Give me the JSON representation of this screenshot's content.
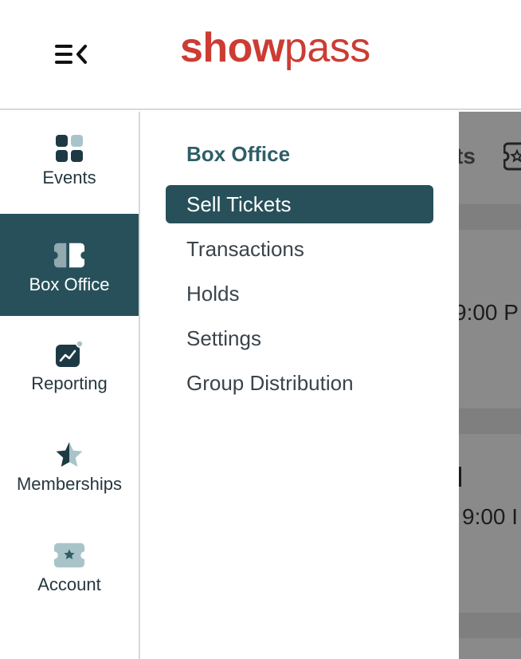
{
  "header": {
    "logo_bold": "show",
    "logo_light": "pass"
  },
  "rail": {
    "items": [
      {
        "label": "Events",
        "icon": "grid-icon"
      },
      {
        "label": "Box Office",
        "icon": "ticket-icon",
        "active": true
      },
      {
        "label": "Reporting",
        "icon": "chart-icon"
      },
      {
        "label": "Memberships",
        "icon": "star-icon"
      },
      {
        "label": "Account",
        "icon": "account-ticket-icon"
      }
    ]
  },
  "submenu": {
    "title": "Box Office",
    "items": [
      {
        "label": "Sell Tickets",
        "active": true
      },
      {
        "label": "Transactions"
      },
      {
        "label": "Holds"
      },
      {
        "label": "Settings"
      },
      {
        "label": "Group Distribution"
      }
    ]
  },
  "background": {
    "heading_fragment": "ts",
    "time_1": "9:00 P",
    "title_fragment": "l",
    "time_2": "9:00 I"
  },
  "colors": {
    "brand": "#cc3c33",
    "active_bg": "#27505a",
    "title": "#2f5e66"
  }
}
